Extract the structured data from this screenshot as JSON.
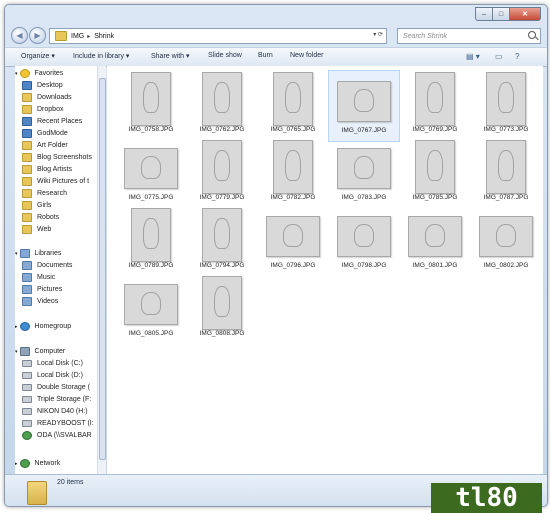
{
  "window": {
    "caption_buttons": {
      "minimize": "–",
      "maximize": "□",
      "close": "✕"
    }
  },
  "address_bar": {
    "crumbs": [
      "IMG",
      "Shrink"
    ],
    "separator": "▸",
    "icon": "folder-icon"
  },
  "search": {
    "placeholder": "Search Shrink",
    "icon": "search-icon"
  },
  "toolbar": {
    "organize": "Organize ▾",
    "include_in_library": "Include in library ▾",
    "share_with": "Share with ▾",
    "slide_show": "Slide show",
    "burn": "Burn",
    "new_folder": "New folder",
    "view_icon": "view-options-icon",
    "help_icon": "help-icon"
  },
  "nav": {
    "favorites_label": "Favorites",
    "favorites": [
      "Desktop",
      "Downloads",
      "Dropbox",
      "Recent Places",
      "GodMode",
      "Art Folder",
      "Blog Screenshots",
      "Blog Artists",
      "Wiki Pictures of t",
      "Research",
      "Girls",
      "Robots",
      "Web"
    ],
    "libraries_label": "Libraries",
    "libraries": [
      "Documents",
      "Music",
      "Pictures",
      "Videos"
    ],
    "homegroup_label": "Homegroup",
    "computer_label": "Computer",
    "computer": [
      "Local Disk (C:)",
      "Local Disk (D:)",
      "Double Storage (",
      "Triple Storage (F:",
      "NIKON D40 (H:)",
      "READYBOOST (I:",
      "ODA (\\\\SVALBAR"
    ],
    "network_label": "Network"
  },
  "files": [
    {
      "name": "IMG_0758.JPG",
      "orientation": "portrait"
    },
    {
      "name": "IMG_0762.JPG",
      "orientation": "portrait"
    },
    {
      "name": "IMG_0765.JPG",
      "orientation": "portrait"
    },
    {
      "name": "IMG_0767.JPG",
      "orientation": "landscape",
      "selected": true
    },
    {
      "name": "IMG_0769.JPG",
      "orientation": "portrait"
    },
    {
      "name": "IMG_0773.JPG",
      "orientation": "portrait"
    },
    {
      "name": "IMG_0775.JPG",
      "orientation": "landscape"
    },
    {
      "name": "IMG_0779.JPG",
      "orientation": "portrait"
    },
    {
      "name": "IMG_0782.JPG",
      "orientation": "portrait"
    },
    {
      "name": "IMG_0783.JPG",
      "orientation": "landscape"
    },
    {
      "name": "IMG_0785.JPG",
      "orientation": "portrait"
    },
    {
      "name": "IMG_0787.JPG",
      "orientation": "portrait"
    },
    {
      "name": "IMG_0789.JPG",
      "orientation": "portrait"
    },
    {
      "name": "IMG_0794.JPG",
      "orientation": "portrait"
    },
    {
      "name": "IMG_0796.JPG",
      "orientation": "landscape"
    },
    {
      "name": "IMG_0798.JPG",
      "orientation": "landscape"
    },
    {
      "name": "IMG_0801.JPG",
      "orientation": "landscape"
    },
    {
      "name": "IMG_0802.JPG",
      "orientation": "landscape"
    },
    {
      "name": "IMG_0805.JPG",
      "orientation": "landscape"
    },
    {
      "name": "IMG_0808.JPG",
      "orientation": "portrait"
    }
  ],
  "status": {
    "count": "20 items"
  },
  "watermark": {
    "text": "tl80"
  },
  "colors": {
    "toolbar_text": "#1e2d44",
    "logo_bg": "#3c6b1f",
    "selection": "#e8f1fb"
  }
}
